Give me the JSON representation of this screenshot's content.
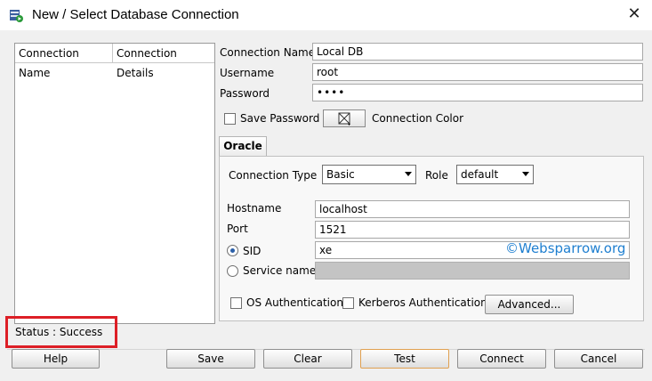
{
  "window": {
    "title": "New / Select Database Connection"
  },
  "list": {
    "col_name": "Connection Name",
    "col_details": "Connection Details"
  },
  "form": {
    "conn_name_label": "Connection Name",
    "conn_name_value": "Local DB",
    "username_label": "Username",
    "username_value": "root",
    "password_label": "Password",
    "password_value": "••••",
    "save_password_label": "Save Password",
    "conn_color_label": "Connection Color"
  },
  "tab": {
    "label": "Oracle"
  },
  "oracle": {
    "conn_type_label": "Connection Type",
    "conn_type_value": "Basic",
    "role_label": "Role",
    "role_value": "default",
    "hostname_label": "Hostname",
    "hostname_value": "localhost",
    "port_label": "Port",
    "port_value": "1521",
    "sid_label": "SID",
    "sid_value": "xe",
    "service_label": "Service name",
    "os_auth_label": "OS Authentication",
    "kerberos_label": "Kerberos Authentication",
    "advanced_label": "Advanced..."
  },
  "watermark": "©Websparrow.org",
  "status": "Status : Success",
  "buttons": {
    "help": "Help",
    "save": "Save",
    "clear": "Clear",
    "test": "Test",
    "connect": "Connect",
    "cancel": "Cancel"
  },
  "colors": {
    "highlight": "#dd1f26",
    "watermark": "#1f7fd0",
    "radio_dot": "#2b5fa8"
  }
}
